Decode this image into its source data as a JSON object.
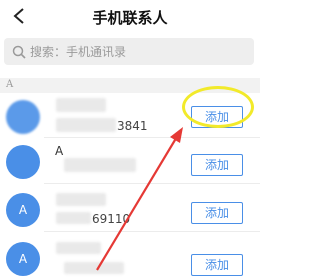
{
  "header": {
    "title": "手机联系人",
    "back_icon": "chevron-left-icon"
  },
  "search": {
    "placeholder": "搜索：手机通讯录",
    "icon": "search-icon"
  },
  "section": {
    "letter": "A"
  },
  "contacts": [
    {
      "avatar": "",
      "name": "",
      "phone_suffix": "3841",
      "add_label": "添加"
    },
    {
      "avatar": "",
      "name": "A",
      "phone_suffix": "",
      "add_label": "添加"
    },
    {
      "avatar": "A",
      "name": "",
      "phone_suffix": "69110",
      "add_label": "添加"
    },
    {
      "avatar": "A",
      "name": "",
      "phone_suffix": "",
      "add_label": "添加"
    }
  ],
  "colors": {
    "accent": "#4a8fe7",
    "highlight_ellipse": "#f2ea2a",
    "annotation_arrow": "#e53935"
  }
}
